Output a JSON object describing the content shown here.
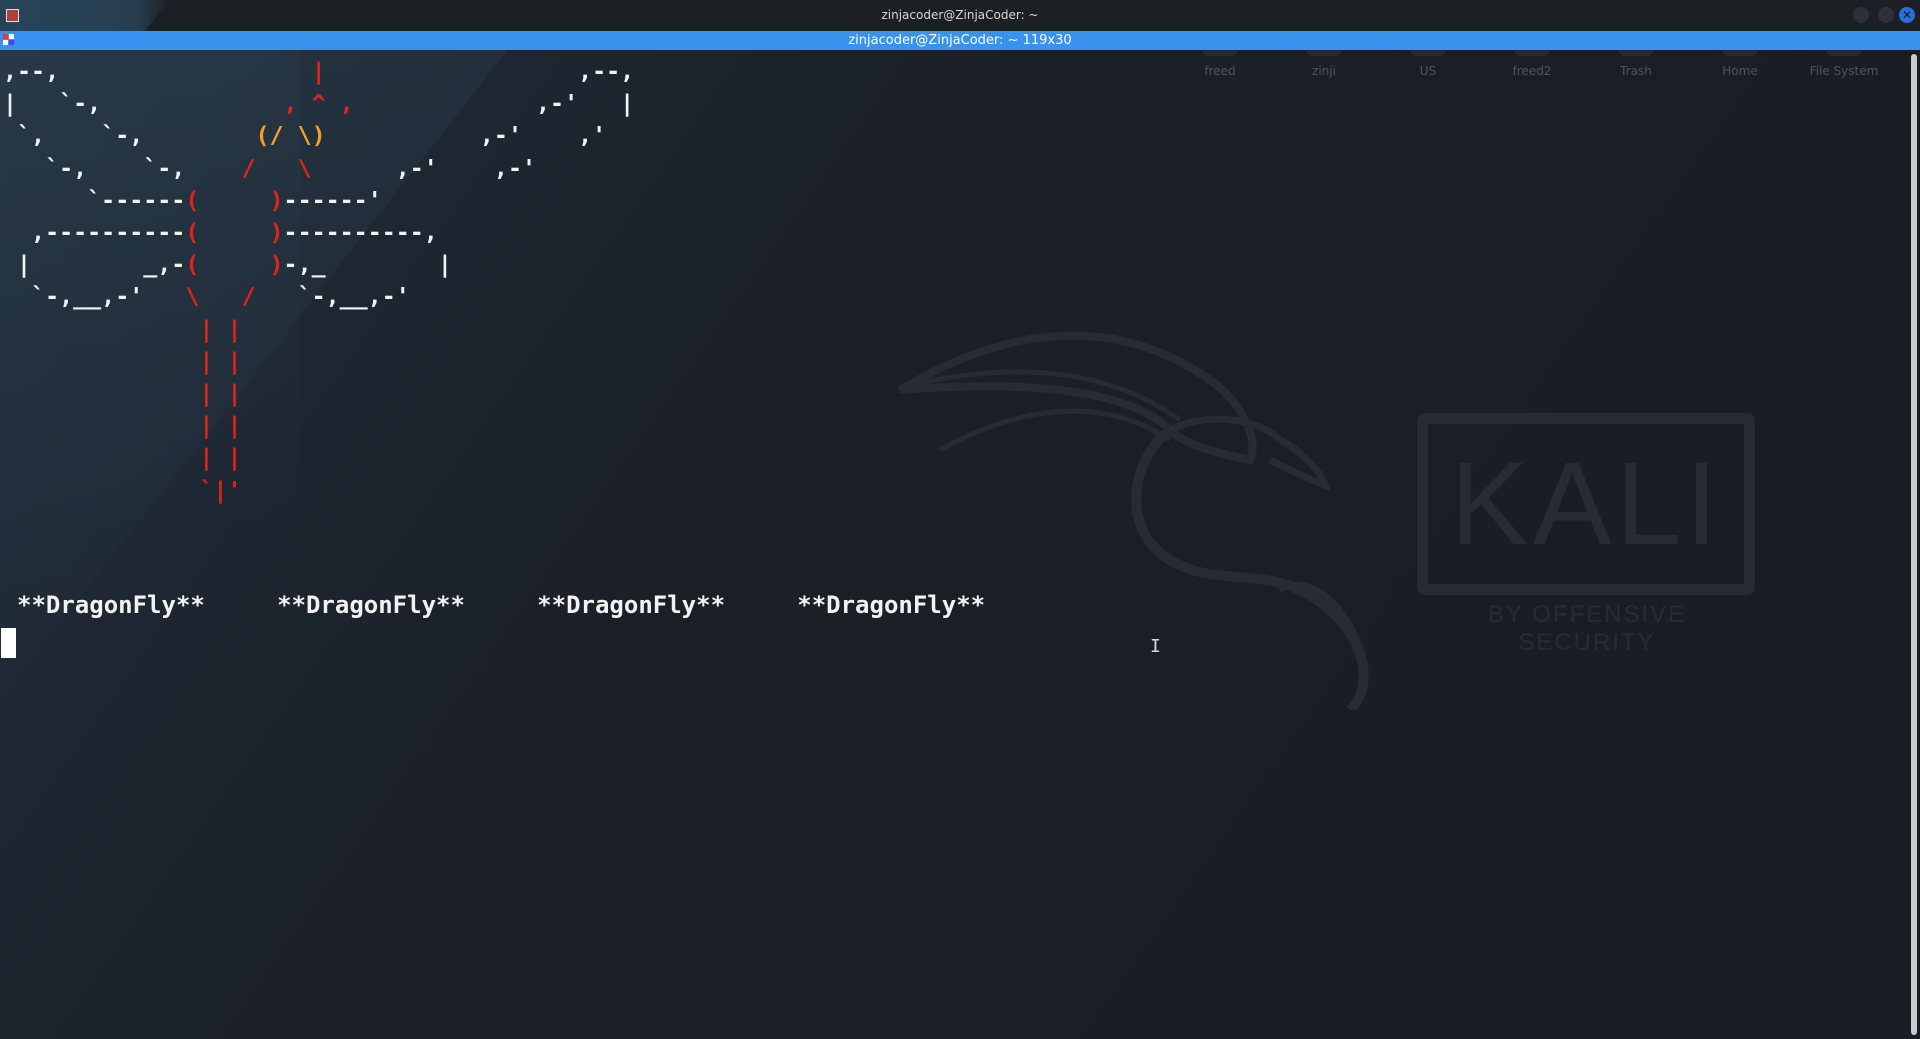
{
  "window": {
    "title": "zinjacoder@ZinjaCoder: ~"
  },
  "terminal": {
    "tab_title": "zinjacoder@ZinjaCoder: ~ 119x30",
    "banner": "**DragonFly**     **DragonFly**     **DragonFly**     **DragonFly**",
    "ascii_art": [
      ",--,                  |                  ,--,",
      "|   `-,             , ^ ,             ,-'   |",
      " `,    `-,        (/ \\)           ,-'    ,'",
      "   `-,    `-,    /   \\      ,-'    ,-'",
      "      `------(     )------'",
      "  ,----------(     )----------,",
      " |        _,-(     )-,_        |",
      "  `-,__,-'   \\   /   `-,__,-'",
      "              | |",
      "              | |",
      "              | |",
      "              | |",
      "              | |",
      "              `|'"
    ]
  },
  "desktop": {
    "icons": [
      "freed",
      "zinji",
      "US",
      "freed2",
      "Trash",
      "Home",
      "File System"
    ]
  },
  "wallpaper": {
    "logo_text": "KALI",
    "logo_subtitle": "BY OFFENSIVE SECURITY"
  },
  "colors": {
    "tab_bar": "#3792f0",
    "body_red": "#e2231a",
    "eyes_orange": "#f5a028",
    "text": "#f2f2f2"
  }
}
